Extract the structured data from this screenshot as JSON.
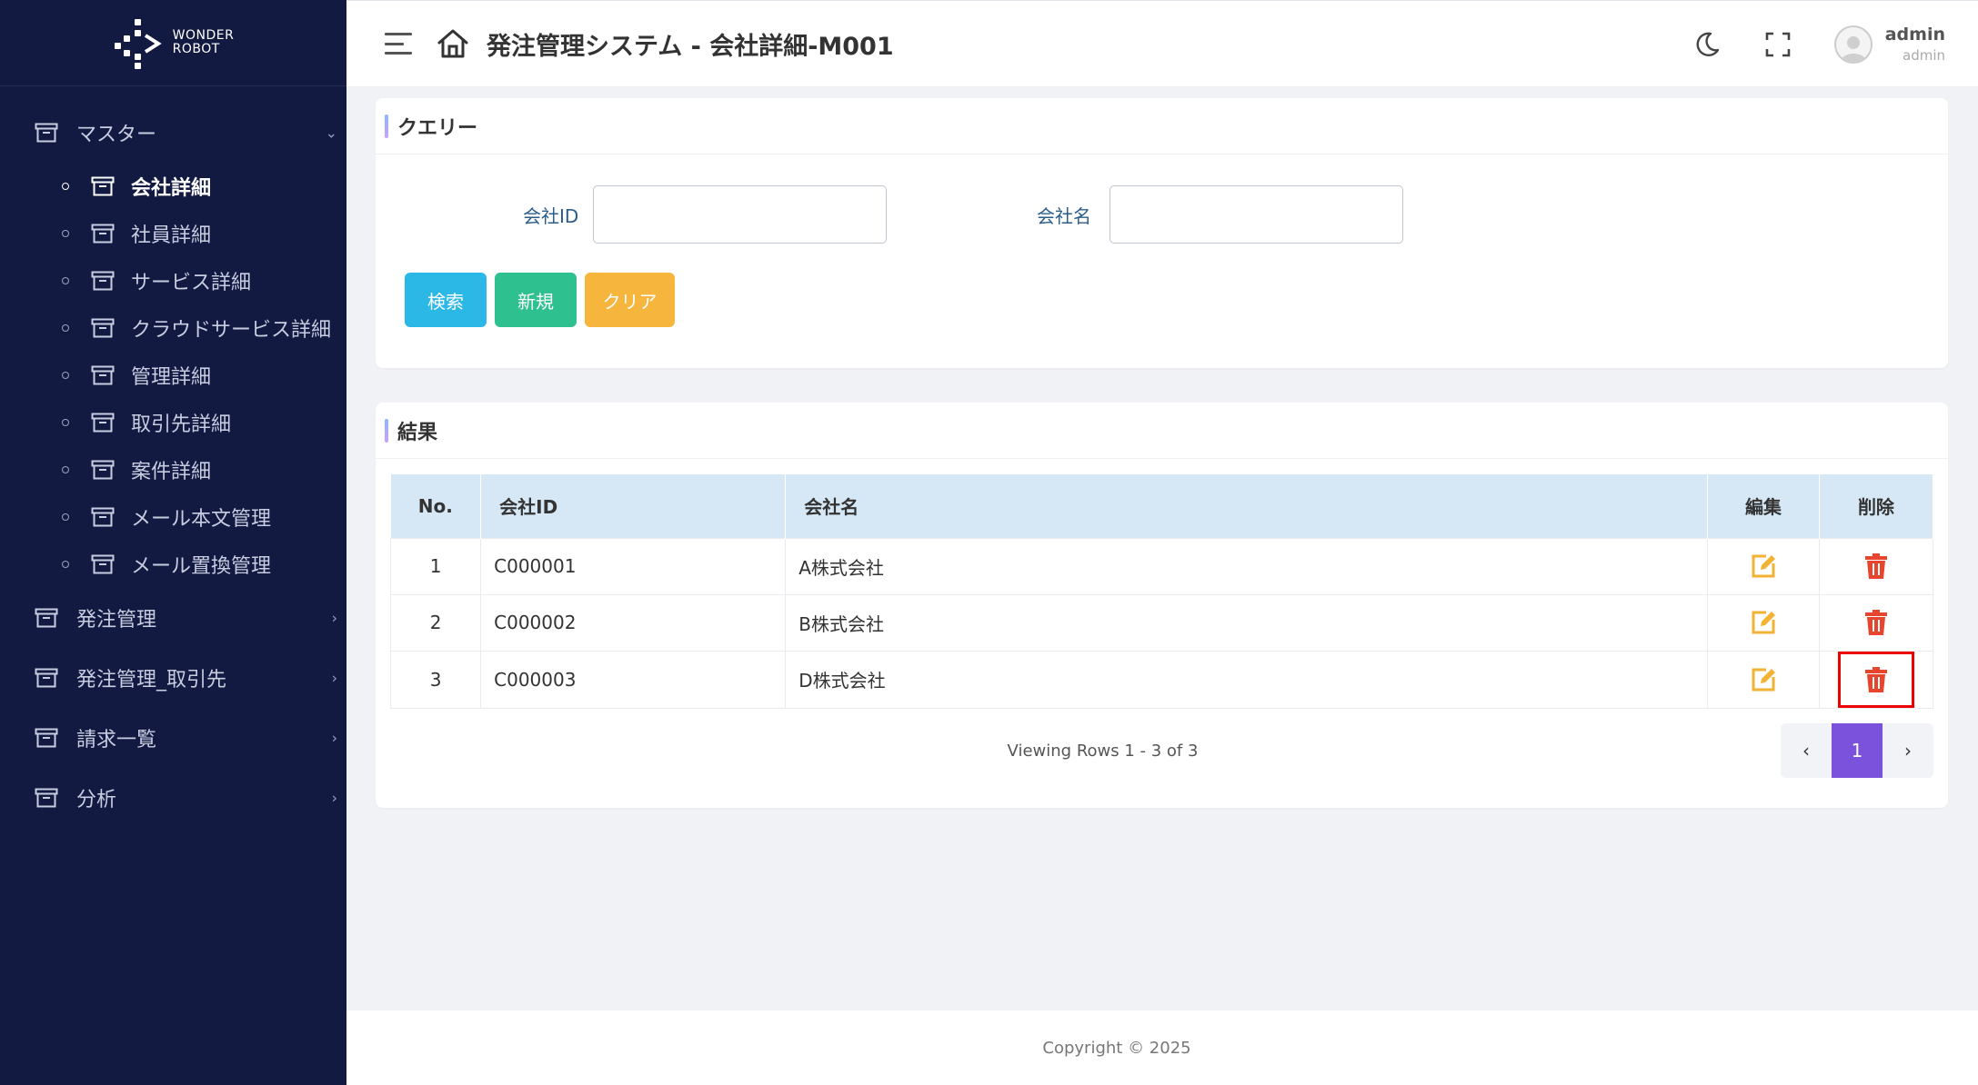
{
  "logo": {
    "line1": "WONDER",
    "line2": "ROBOT"
  },
  "sidebar": {
    "groups": [
      {
        "label": "マスター",
        "expanded": true
      },
      {
        "label": "発注管理"
      },
      {
        "label": "発注管理_取引先"
      },
      {
        "label": "請求一覧"
      },
      {
        "label": "分析"
      }
    ],
    "master_items": [
      {
        "label": "会社詳細",
        "active": true
      },
      {
        "label": "社員詳細"
      },
      {
        "label": "サービス詳細"
      },
      {
        "label": "クラウドサービス詳細"
      },
      {
        "label": "管理詳細"
      },
      {
        "label": "取引先詳細"
      },
      {
        "label": "案件詳細"
      },
      {
        "label": "メール本文管理"
      },
      {
        "label": "メール置換管理"
      }
    ]
  },
  "header": {
    "title": "発注管理システム - 会社詳細-M001",
    "user_name": "admin",
    "user_role": "admin"
  },
  "query": {
    "title": "クエリー",
    "company_id_label": "会社ID",
    "company_id_value": "",
    "company_name_label": "会社名",
    "company_name_value": "",
    "search_label": "検索",
    "new_label": "新規",
    "clear_label": "クリア"
  },
  "results": {
    "title": "結果",
    "columns": [
      "No.",
      "会社ID",
      "会社名",
      "編集",
      "削除"
    ],
    "rows": [
      {
        "no": "1",
        "id": "C000001",
        "name": "A株式会社"
      },
      {
        "no": "2",
        "id": "C000002",
        "name": "B株式会社"
      },
      {
        "no": "3",
        "id": "C000003",
        "name": "D株式会社"
      }
    ],
    "viewing": "Viewing Rows 1 - 3 of 3",
    "current_page": "1"
  },
  "footer": {
    "copyright": "Copyright © 2025"
  },
  "colors": {
    "sidebar_bg": "#121a42",
    "search_btn": "#2bb8e6",
    "new_btn": "#2ec08f",
    "clear_btn": "#f6b53c",
    "edit_icon": "#f2b335",
    "delete_icon": "#e8452f",
    "page_active": "#7b52dc"
  }
}
